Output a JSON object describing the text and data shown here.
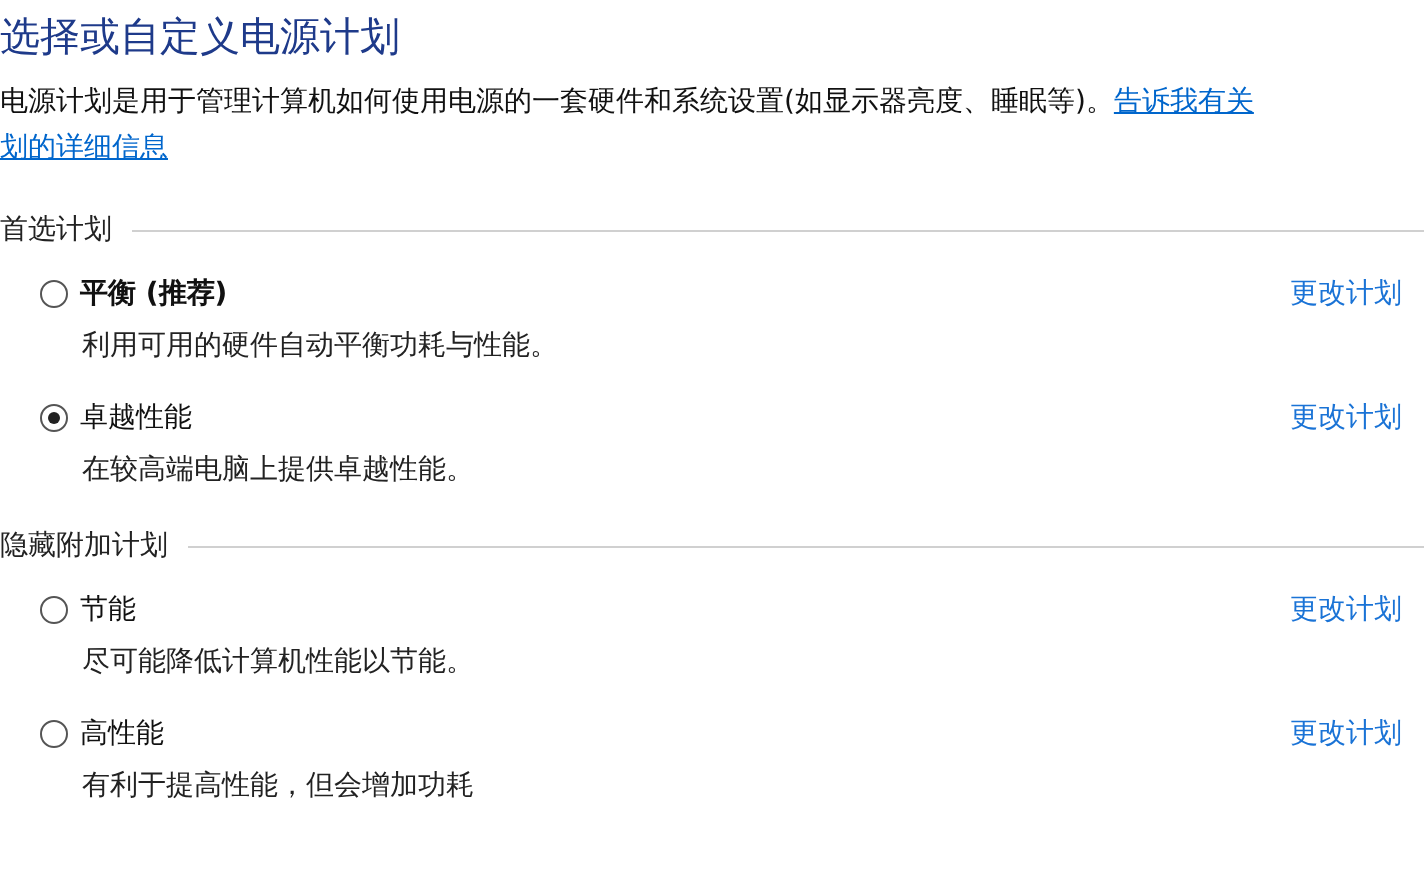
{
  "title": "选择或自定义电源计划",
  "description": {
    "text": "电源计划是用于管理计算机如何使用电源的一套硬件和系统设置(如显示器亮度、睡眠等)。",
    "links": [
      "告诉我有关",
      "划的详细信息"
    ]
  },
  "sections": [
    {
      "heading": "首选计划",
      "plans": [
        {
          "name": "平衡 (推荐)",
          "emphasized": true,
          "selected": false,
          "description": "利用可用的硬件自动平衡功耗与性能。",
          "link": "更改计划"
        },
        {
          "name": "卓越性能",
          "emphasized": false,
          "selected": true,
          "description": "在较高端电脑上提供卓越性能。",
          "link": "更改计划"
        }
      ]
    },
    {
      "heading": "隐藏附加计划",
      "plans": [
        {
          "name": "节能",
          "emphasized": false,
          "selected": false,
          "description": "尽可能降低计算机性能以节能。",
          "link": "更改计划"
        },
        {
          "name": "高性能",
          "emphasized": false,
          "selected": false,
          "description": "有利于提高性能，但会增加功耗",
          "link": "更改计划"
        }
      ]
    }
  ]
}
